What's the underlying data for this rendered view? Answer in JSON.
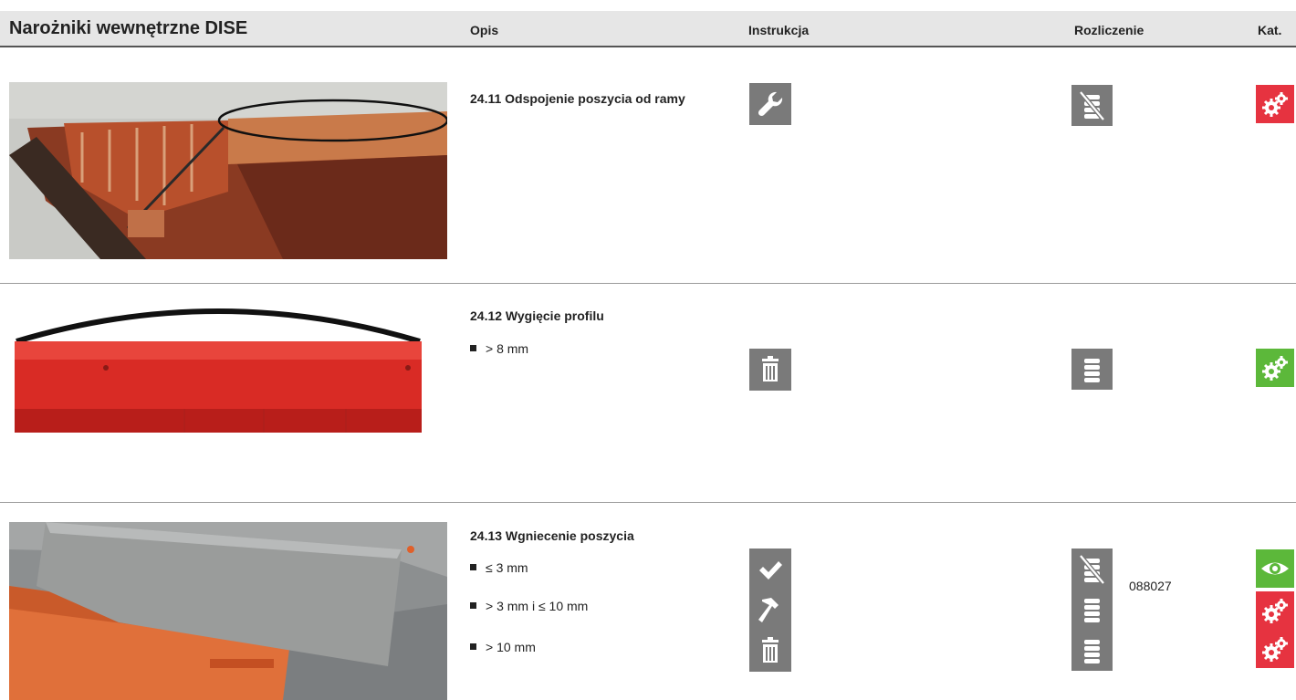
{
  "header": {
    "title": "Narożniki wewnętrzne DISE",
    "columns": {
      "opis": "Opis",
      "instrukcja": "Instrukcja",
      "rozliczenie": "Rozliczenie",
      "kat": "Kat."
    }
  },
  "sections": [
    {
      "title": "24.11 Odspojenie poszycia od ramy",
      "items": [
        {
          "label": "",
          "instruction_icon": "wrench-icon",
          "billing_icon": "no-billing-coins-icon",
          "billing_code": "",
          "category_icon": "gears-icon",
          "category_color": "#e63340"
        }
      ]
    },
    {
      "title": "24.12 Wygięcie profilu",
      "items": [
        {
          "label": "> 8 mm",
          "instruction_icon": "trash-icon",
          "billing_icon": "coins-icon",
          "billing_code": "",
          "category_icon": "gears-icon",
          "category_color": "#5cb83a"
        }
      ]
    },
    {
      "title": "24.13 Wgniecenie poszycia",
      "items": [
        {
          "label": "≤ 3 mm",
          "instruction_icon": "check-icon",
          "billing_icon": "no-billing-coins-icon",
          "billing_code": "088027",
          "category_icon": "eye-icon",
          "category_color": "#5cb83a"
        },
        {
          "label": "> 3 mm i ≤  10 mm",
          "instruction_icon": "hammer-icon",
          "billing_icon": "coins-icon",
          "billing_code": "",
          "category_icon": "gears-icon",
          "category_color": "#e63340"
        },
        {
          "label": "> 10 mm",
          "instruction_icon": "trash-icon",
          "billing_icon": "coins-icon",
          "billing_code": "",
          "category_icon": "gears-icon",
          "category_color": "#e63340"
        }
      ]
    }
  ]
}
